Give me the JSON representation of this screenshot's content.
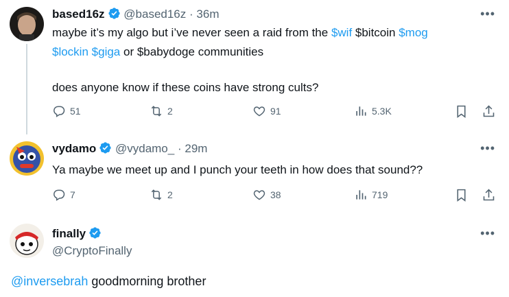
{
  "tweets": [
    {
      "name": "based16z",
      "handle": "@based16z",
      "sep": "·",
      "time": "36m",
      "more": "•••",
      "line1": [
        "maybe it’s my algo but i’ve never seen a raid from the ",
        "$wif",
        " $bitcoin ",
        "$mog"
      ],
      "line2": [
        "$lockin",
        " ",
        "$giga",
        " or $babydoge communities"
      ],
      "line3": "does anyone know if these coins have strong cults?",
      "replies": "51",
      "reposts": "2",
      "likes": "91",
      "views": "5.3K"
    },
    {
      "name": "vydamo",
      "handle": "@vydamo_",
      "sep": "·",
      "time": "29m",
      "more": "•••",
      "text": "Ya maybe we meet up and I punch your teeth in how does that sound??",
      "replies": "7",
      "reposts": "2",
      "likes": "38",
      "views": "719"
    },
    {
      "name": "finally",
      "handle": "@CryptoFinally",
      "more": "•••",
      "mention": "@inversebrah",
      "text": " goodmorning brother"
    }
  ],
  "colors": {
    "accent": "#1d9bf0",
    "muted": "#536471",
    "text": "#0f1419"
  },
  "icons": [
    "verified-badge-icon",
    "reply-icon",
    "repost-icon",
    "like-icon",
    "views-icon",
    "bookmark-icon",
    "share-icon",
    "more-icon"
  ]
}
